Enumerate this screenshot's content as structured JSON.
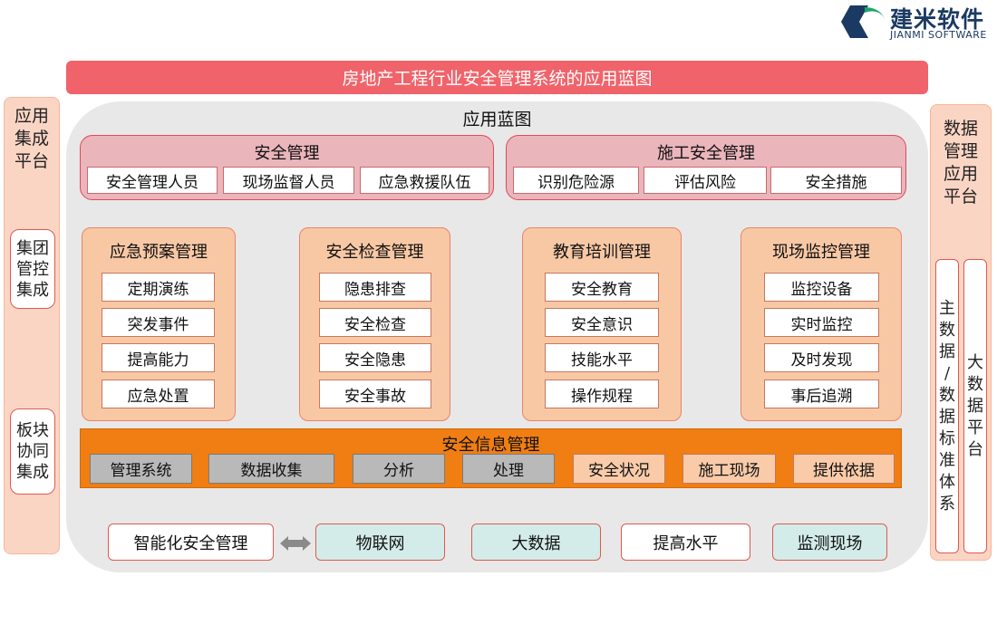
{
  "logo": {
    "name": "建米软件",
    "sub": "JIANMI SOFTWARE"
  },
  "title": "房地产工程行业安全管理系统的应用蓝图",
  "main_title": "应用蓝图",
  "left_side": {
    "title": "应用\n集成\n平台",
    "boxes": [
      "集团\n管控\n集成",
      "板块\n协同\n集成"
    ]
  },
  "right_side": {
    "title": "数据\n管理\n应用\n平台",
    "col1": "主\n数\n据\n/\n数\n据\n标\n准\n体\n系",
    "col2": "大\n数\n据\n平\n台"
  },
  "top_panels": [
    {
      "title": "安全管理",
      "items": [
        "安全管理人员",
        "现场监督人员",
        "应急救援队伍"
      ]
    },
    {
      "title": "施工安全管理",
      "items": [
        "识别危险源",
        "评估风险",
        "安全措施"
      ]
    }
  ],
  "mid_panels": [
    {
      "title": "应急预案管理",
      "items": [
        "定期演练",
        "突发事件",
        "提高能力",
        "应急处置"
      ]
    },
    {
      "title": "安全检查管理",
      "items": [
        "隐患排查",
        "安全检查",
        "安全隐患",
        "安全事故"
      ]
    },
    {
      "title": "教育培训管理",
      "items": [
        "安全教育",
        "安全意识",
        "技能水平",
        "操作规程"
      ]
    },
    {
      "title": "现场监控管理",
      "items": [
        "监控设备",
        "实时监控",
        "及时发现",
        "事后追溯"
      ]
    }
  ],
  "info_panel": {
    "title": "安全信息管理",
    "gray_items": [
      "管理系统",
      "数据收集",
      "分析",
      "处理"
    ],
    "peach_items": [
      "安全状况",
      "施工现场",
      "提供依据"
    ]
  },
  "bottom_row": {
    "left": "智能化安全管理",
    "items": [
      "物联网",
      "大数据",
      "提高水平",
      "监测现场"
    ]
  },
  "colors": {
    "title_bar": "#f0636a",
    "pink_panel": "#ebb5bc",
    "peach_panel": "#f8c8a5",
    "orange_panel": "#f07e12",
    "teal_box": "#d3ecea"
  }
}
